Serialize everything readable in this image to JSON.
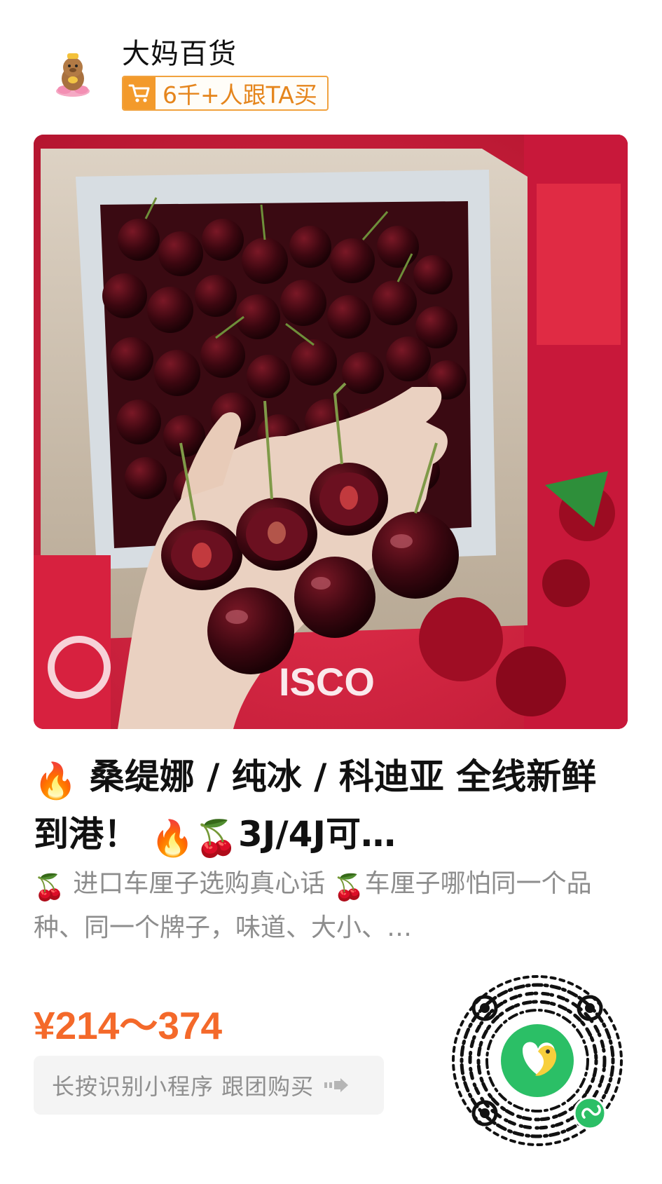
{
  "shop": {
    "name": "大妈百货",
    "buyers_badge": "6千+人跟TA买",
    "avatar_icon": "mascot-avatar-icon",
    "cart_icon": "shopping-cart-icon"
  },
  "product": {
    "image_alt_icon": "cherries-photo",
    "title_parts": [
      "🔥",
      "桑缇娜 / 纯冰 / 科迪亚 全线新鲜到港！",
      "🔥🍒",
      "3J/4J可…"
    ],
    "desc_parts": [
      "🍒",
      "进口车厘子选购真心话",
      "🍒",
      "车厘子哪怕同一个品种、同一个牌子，味道、大小、…"
    ],
    "price": "¥214～374"
  },
  "action": {
    "button_label": "长按识别小程序 跟团购买",
    "arrow_icon": "forward-arrow-icon"
  },
  "colors": {
    "price": "#f4692a",
    "badge_border": "#f1a23e",
    "badge_text": "#e5851c",
    "qr_center": "#2bbf66"
  }
}
